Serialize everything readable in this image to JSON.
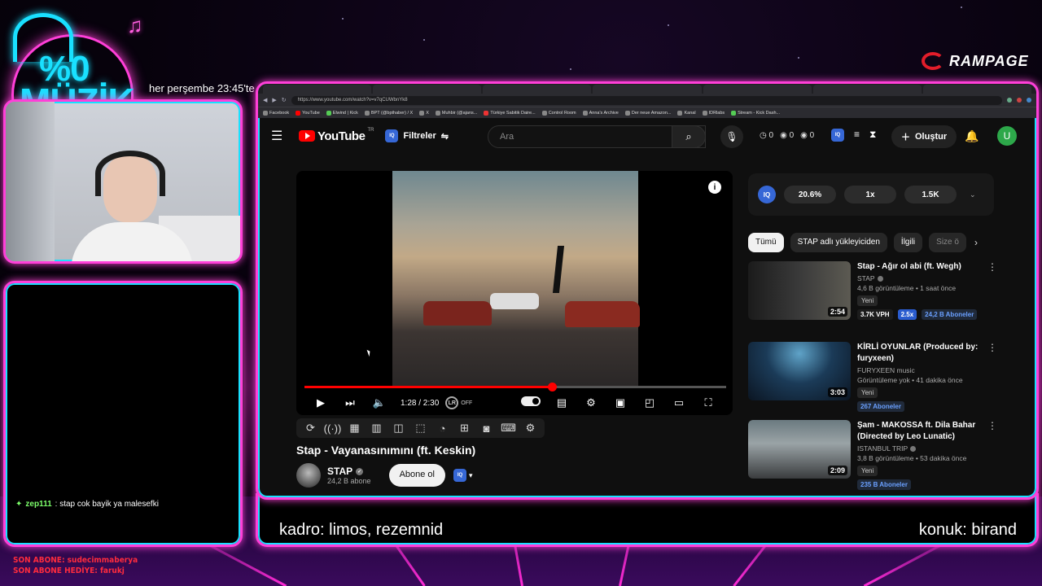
{
  "stream": {
    "schedule": "her perşembe 23:45'te",
    "logo": {
      "pct": "%0",
      "word": "MÜZİK"
    },
    "sponsor": "RAMPAGE",
    "chat": [
      {
        "user": "zep111",
        "text": ": stap cok bayik ya malesefki"
      }
    ],
    "last_sub": "SON ABONE: sudecimmaberya",
    "last_gift": "SON ABONE HEDİYE: farukj",
    "bottom_left": "kadro: limos, rezemnid",
    "bottom_right": "konuk: birand"
  },
  "browser": {
    "url": "https://www.youtube.com/watch?v=v7qCUWbnYk8",
    "bookmarks": [
      "Facebook",
      "YouTube",
      "Elwind | Kick",
      "BPT (@bpthaber) / X",
      "X",
      "Muhbir (@ajans...",
      "Türkiye Sabitik Daire...",
      "Control Room",
      "Anna's Archive",
      "Der neue Amazon...",
      "Kanal",
      "IDRlabs",
      "Stream - Kick Dash..."
    ]
  },
  "yt": {
    "region": "TR",
    "filters_label": "Filtreler",
    "search_placeholder": "Ara",
    "counter1": "0",
    "counter2": "0",
    "counter3": "0",
    "create_label": "Oluştur",
    "avatar_letter": "U",
    "player": {
      "time": "1:28 / 2:30",
      "progress": 0.587,
      "autoplay_label": "OFF"
    },
    "video_title": "Stap - Vayanasınımını (ft. Keskin)",
    "channel_name": "STAP",
    "channel_subs": "24,2 B abone",
    "subscribe_label": "Abone ol",
    "iq_panel": {
      "p1": "20.6%",
      "p2": "1x",
      "p3": "1.5K"
    },
    "chips": [
      "Tümü",
      "STAP adlı yükleyiciden",
      "İlgili",
      "Size ö"
    ],
    "recs": [
      {
        "title": "Stap - Ağır ol abi (ft. Wegh)",
        "channel": "STAP",
        "views": "4,6 B görüntüleme • 1 saat önce",
        "badge": "Yeni",
        "duration": "2:54",
        "vph": "3.7K VPH",
        "mult": "2.5x",
        "subs": "24,2 B Aboneler"
      },
      {
        "title": "KİRLİ OYUNLAR (Produced by: furyxeen)",
        "channel": "FURYXEEN music",
        "views": "Görüntüleme yok • 41 dakika önce",
        "badge": "Yeni",
        "duration": "3:03",
        "subs": "267 Aboneler"
      },
      {
        "title": "Şam - MAKOSSA ft. Dila Bahar (Directed by Leo Lunatic)",
        "channel": "ISTANBUL TRIP",
        "views": "3,8 B görüntüleme • 53 dakika önce",
        "badge": "Yeni",
        "duration": "2:09",
        "subs": "235 B Aboneler"
      }
    ]
  }
}
